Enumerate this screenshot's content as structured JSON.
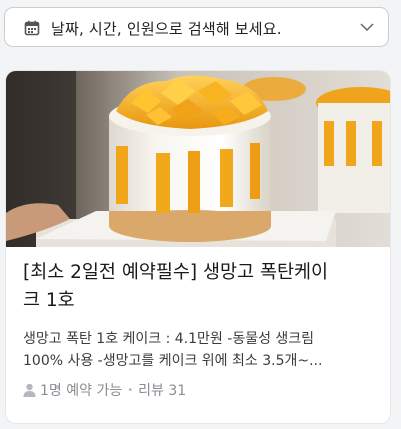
{
  "search": {
    "placeholder_text": "날짜, 시간, 인원으로 검색해 보세요.",
    "icon": "calendar-icon",
    "dropdown_icon": "chevron-down-icon"
  },
  "product": {
    "title_line1": "[최소 2일전 예약필수] 생망고 폭탄케이",
    "title_line2": "크 1호",
    "desc_line1": "생망고 폭탄 1호 케이크 : 4.1만원 -동물성 생크림",
    "desc_line2": "100% 사용 -생망고를 케이크 위에 최소 3.5개~...",
    "booking": "1명 예약 가능",
    "separator": "•",
    "reviews": "리뷰 31",
    "person_icon": "person-icon",
    "image": "mango-cake-photo"
  },
  "colors": {
    "mango": "#f2a81b",
    "cream": "#f7f5ef",
    "meta_text": "#8a8d93"
  }
}
